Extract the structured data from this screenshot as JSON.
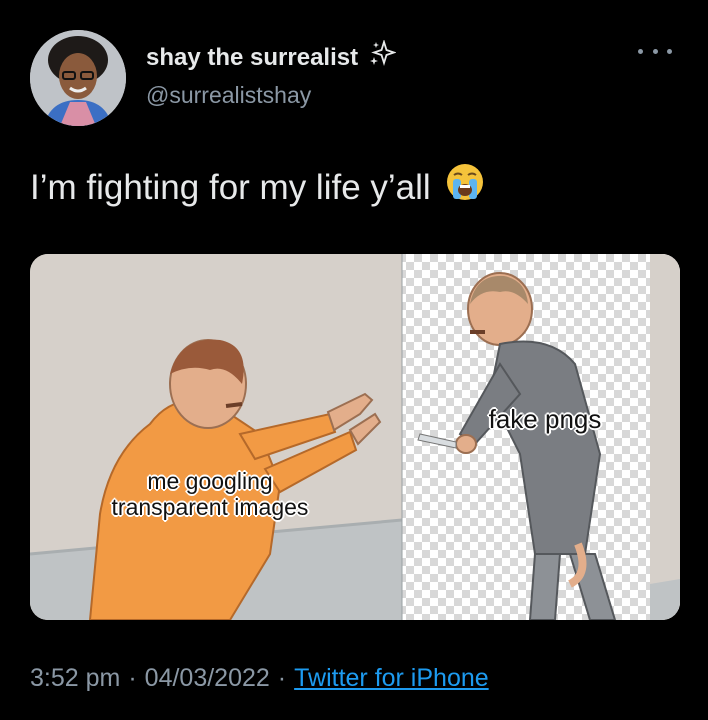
{
  "user": {
    "display_name": "shay the surrealist",
    "handle": "@surrealistshay",
    "name_badge_icon": "sparkles-icon"
  },
  "tweet": {
    "text": "I’m fighting for my life y’all",
    "emoji_icon": "loudly-crying-face-icon"
  },
  "media": {
    "caption_left_line1": "me googling",
    "caption_left_line2": "transparent images",
    "caption_right": "fake pngs"
  },
  "meta": {
    "time": "3:52 pm",
    "separator": "·",
    "date": "04/03/2022",
    "source": "Twitter for iPhone"
  },
  "colors": {
    "background": "#000000",
    "text": "#e7e9ea",
    "muted": "#8b98a5",
    "link": "#1d9bf0"
  }
}
